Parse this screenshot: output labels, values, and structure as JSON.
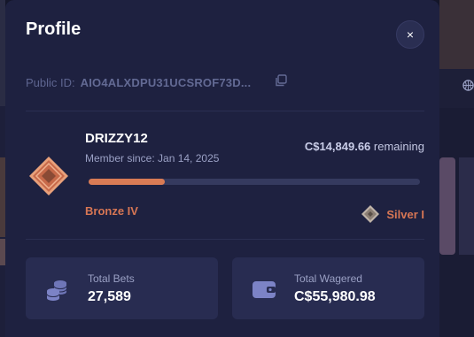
{
  "modal": {
    "title": "Profile",
    "close_label": "×"
  },
  "profile": {
    "public_id_label": "Public ID:",
    "public_id_value": "AIO4ALXDPU31UCSROF73D...",
    "username": "DRIZZY12",
    "member_since": "Member since: Jan 14, 2025",
    "remaining_amount": "C$14,849.66",
    "remaining_suffix": "remaining",
    "progress_fraction": 0.23,
    "current_rank": "Bronze IV",
    "next_rank": "Silver I"
  },
  "stats": [
    {
      "label": "Total Bets",
      "value": "27,589",
      "icon": "coins-stack-icon"
    },
    {
      "label": "Total Wagered",
      "value": "C$55,980.98",
      "icon": "wallet-icon"
    }
  ],
  "colors": {
    "modal_bg": "#1e2140",
    "card_bg": "#282c51",
    "accent": "#d97b55",
    "muted_text": "#9aa0c4",
    "icon_purple": "#6f76b8"
  }
}
